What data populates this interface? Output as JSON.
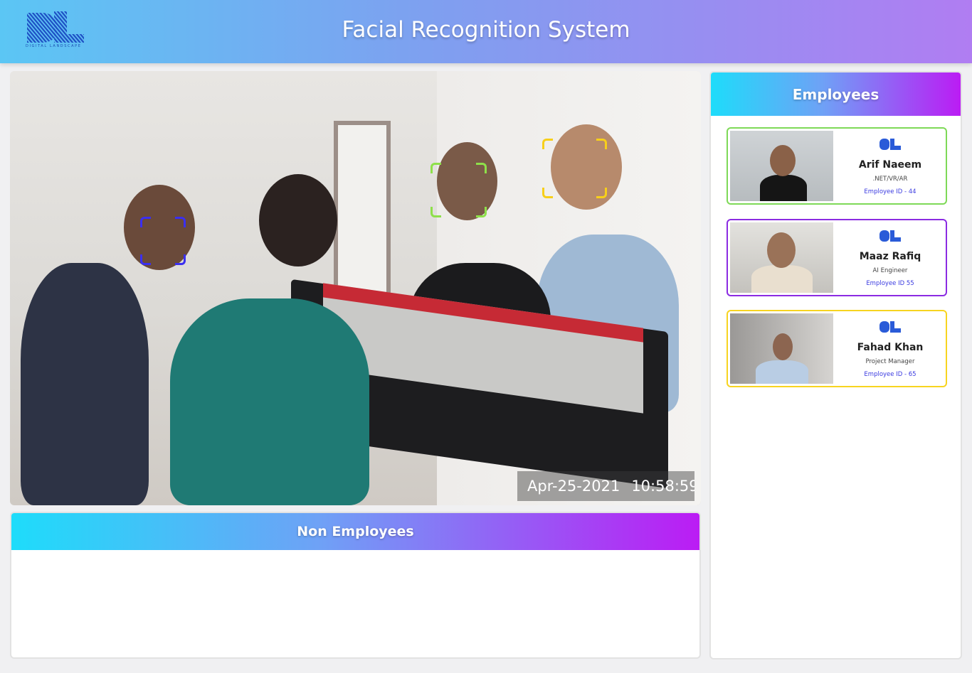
{
  "header": {
    "title": "Facial Recognition System",
    "logo_text": "DIGITAL LANDSCAPE"
  },
  "feed": {
    "date": "Apr-25-2021",
    "time": "10:58:59",
    "face_box_colors": [
      "#3b2ff0",
      "#8ee04a",
      "#f7cf1a"
    ]
  },
  "non_employees": {
    "title": "Non Employees"
  },
  "employees": {
    "title": "Employees",
    "cards": [
      {
        "name": "Arif Naeem",
        "role": ".NET/VR/AR",
        "employee_id": "Employee ID - 44",
        "border_color": "#7ed957"
      },
      {
        "name": "Maaz Rafiq",
        "role": "AI Engineer",
        "employee_id": "Employee ID 55",
        "border_color": "#8b2be2"
      },
      {
        "name": "Fahad Khan",
        "role": "Project Manager",
        "employee_id": "Employee ID - 65",
        "border_color": "#f7d420"
      }
    ]
  },
  "colors": {
    "header_gradient_start": "#5bc6f4",
    "header_gradient_end": "#b07df2",
    "panel_gradient_start": "#1edcfa",
    "panel_gradient_end": "#bb1cf4"
  }
}
